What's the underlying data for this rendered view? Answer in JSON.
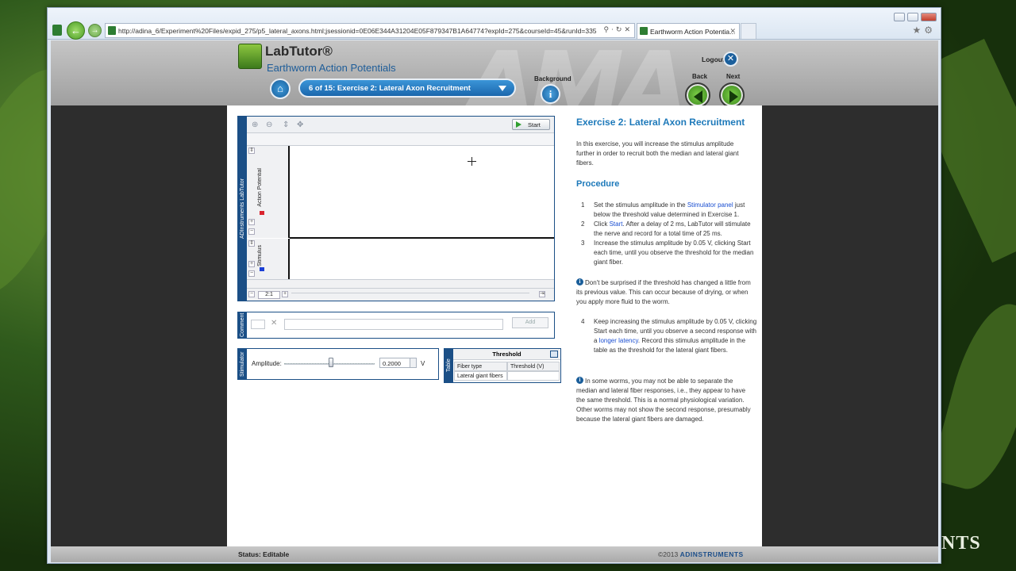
{
  "browser": {
    "url": "http://adina_6/Experiment%20Files/expid_275/p5_lateral_axons.html;jsessionid=0E06E344A31204E05F879347B1A64774?expId=275&courseId=45&runId=335",
    "tab_title": "Earthworm Action Potentia...",
    "controls": [
      "search-icon",
      "refresh-icon",
      "stop-icon"
    ]
  },
  "header": {
    "logo_text": "LabTutor®",
    "subtitle": "Earthworm Action Potentials",
    "page_selector": "6 of 15: Exercise 2: Lateral Axon Recruitment",
    "background_label": "Background",
    "logout_label": "Logout",
    "back_label": "Back",
    "next_label": "Next"
  },
  "chart_view": {
    "side_label": "ADInstruments LabTutor",
    "start_label": "Start",
    "channel1": "Action Potential",
    "channel2": "Stimulus",
    "zoom": "2:1",
    "channel1_color": "#d9232d",
    "channel2_color": "#1a3fd6"
  },
  "comment": {
    "side_label": "Comment",
    "add_label": "Add"
  },
  "stimulator": {
    "side_label": "Stimulator",
    "amplitude_label": "Amplitude:",
    "amplitude_value": "0.2000",
    "unit": "V"
  },
  "table": {
    "side_label": "Table",
    "title": "Threshold",
    "headers": [
      "Fiber type",
      "Threshold (V)"
    ],
    "rows": [
      [
        "Lateral giant fibers",
        ""
      ]
    ]
  },
  "instructions": {
    "title": "Exercise 2: Lateral Axon Recruitment",
    "intro": "In this exercise, you will increase the stimulus amplitude further in order to recruit both the median and lateral giant fibers.",
    "procedure_title": "Procedure",
    "step1_a": "Set the stimulus amplitude in the ",
    "step1_link": "Stimulator panel",
    "step1_b": " just below the threshold value determined in Exercise 1.",
    "step2_a": "Click ",
    "step2_link": "Start",
    "step2_b": ". After a delay of 2 ms, LabTutor will stimulate the nerve and record for a total time of 25 ms.",
    "step3": "Increase the stimulus amplitude by 0.05 V, clicking Start each time, until you observe the threshold for the median giant fiber.",
    "note1": "Don't be surprised if the threshold has changed a little from its previous value. This can occur because of drying, or when you apply more fluid to the worm.",
    "step4_a": "Keep increasing the stimulus amplitude by 0.05 V, clicking Start each time, until you observe a second response with a ",
    "step4_link": "longer latency",
    "step4_b": ". Record this stimulus amplitude in the table as the threshold for the lateral giant fibers.",
    "note2": "In some worms, you may not be able to separate the median and lateral fiber responses, i.e., they appear to have the same threshold. This is a normal physiological variation. Other worms may not show the second response, presumably because the lateral giant fibers are damaged."
  },
  "status": {
    "left": "Status: Editable",
    "copyright": "©2013",
    "company": "ADINSTRUMENTS"
  },
  "background_text": "NTS"
}
